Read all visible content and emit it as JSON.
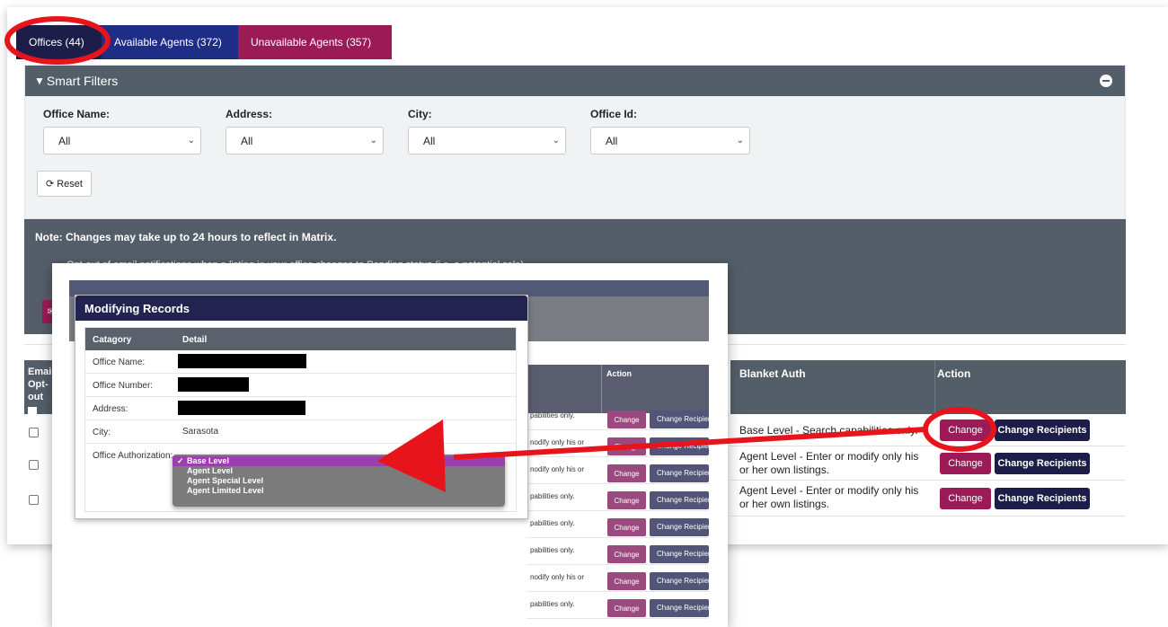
{
  "tabs": [
    {
      "label": "Offices (44)"
    },
    {
      "label": "Available Agents (372)"
    },
    {
      "label": "Unavailable Agents (357)"
    }
  ],
  "filters": {
    "header": "Smart Filters",
    "office_name_label": "Office Name:",
    "address_label": "Address:",
    "city_label": "City:",
    "office_id_label": "Office Id:",
    "office_name_value": "All",
    "address_value": "All",
    "city_value": "All",
    "office_id_value": "All",
    "reset_label": "Reset"
  },
  "note": {
    "text": "Note: Changes may take up to 24 hours to reflect in Matrix.",
    "optout_text": "Opt-out of email notifications when a listing in your office changes to Pending status (i.e. a potential sale)"
  },
  "table": {
    "email_header": "Email Opt-out",
    "blanket_header": "Blanket Auth",
    "action_header": "Action",
    "rows": [
      {
        "blanket": "Base Level - Search capabilities only.",
        "change": "Change",
        "recipients": "Change Recipients"
      },
      {
        "blanket": "Agent Level - Enter or modify only his or her own listings.",
        "change": "Change",
        "recipients": "Change Recipients"
      },
      {
        "blanket": "Agent Level - Enter or modify only his or her own listings.",
        "change": "Change",
        "recipients": "Change Recipients"
      }
    ]
  },
  "popup_table": {
    "action_header": "Action",
    "rows": [
      {
        "text": "pabilities only.",
        "change": "Change",
        "recipients": "Change Recipients"
      },
      {
        "text": "nodify only his or",
        "change": "Change",
        "recipients": "Change Recipients"
      },
      {
        "text": "nodify only his or",
        "change": "Change",
        "recipients": "Change Recipients"
      },
      {
        "text": "pabilities only.",
        "change": "Change",
        "recipients": "Change Recipients"
      },
      {
        "text": "pabilities only.",
        "change": "Change",
        "recipients": "Change Recipients"
      },
      {
        "text": "pabilities only.",
        "change": "Change",
        "recipients": "Change Recipients"
      },
      {
        "text": "nodify only his or",
        "change": "Change",
        "recipients": "Change Recipients"
      },
      {
        "text": "pabilities only.",
        "change": "Change",
        "recipients": "Change Recipients"
      }
    ]
  },
  "modal": {
    "title": "Modifying Records",
    "col_category": "Catagory",
    "col_detail": "Detail",
    "office_name_label": "Office Name:",
    "office_number_label": "Office Number:",
    "address_label": "Address:",
    "city_label": "City:",
    "city_value": "Sarasota",
    "authorization_label": "Office Authorization:"
  },
  "dropdown": {
    "options": [
      "Base Level",
      "Agent Level",
      "Agent Special Level",
      "Agent Limited Level"
    ],
    "selected": "Base Level"
  },
  "colors": {
    "tab_offices": "#1d1d4a",
    "tab_available": "#1e2e86",
    "tab_unavailable": "#9c1a56",
    "panel_gray": "#545e69",
    "button_change": "#9c1a56",
    "button_recipients": "#1d1d4a",
    "annotation_red": "#e8141b"
  }
}
